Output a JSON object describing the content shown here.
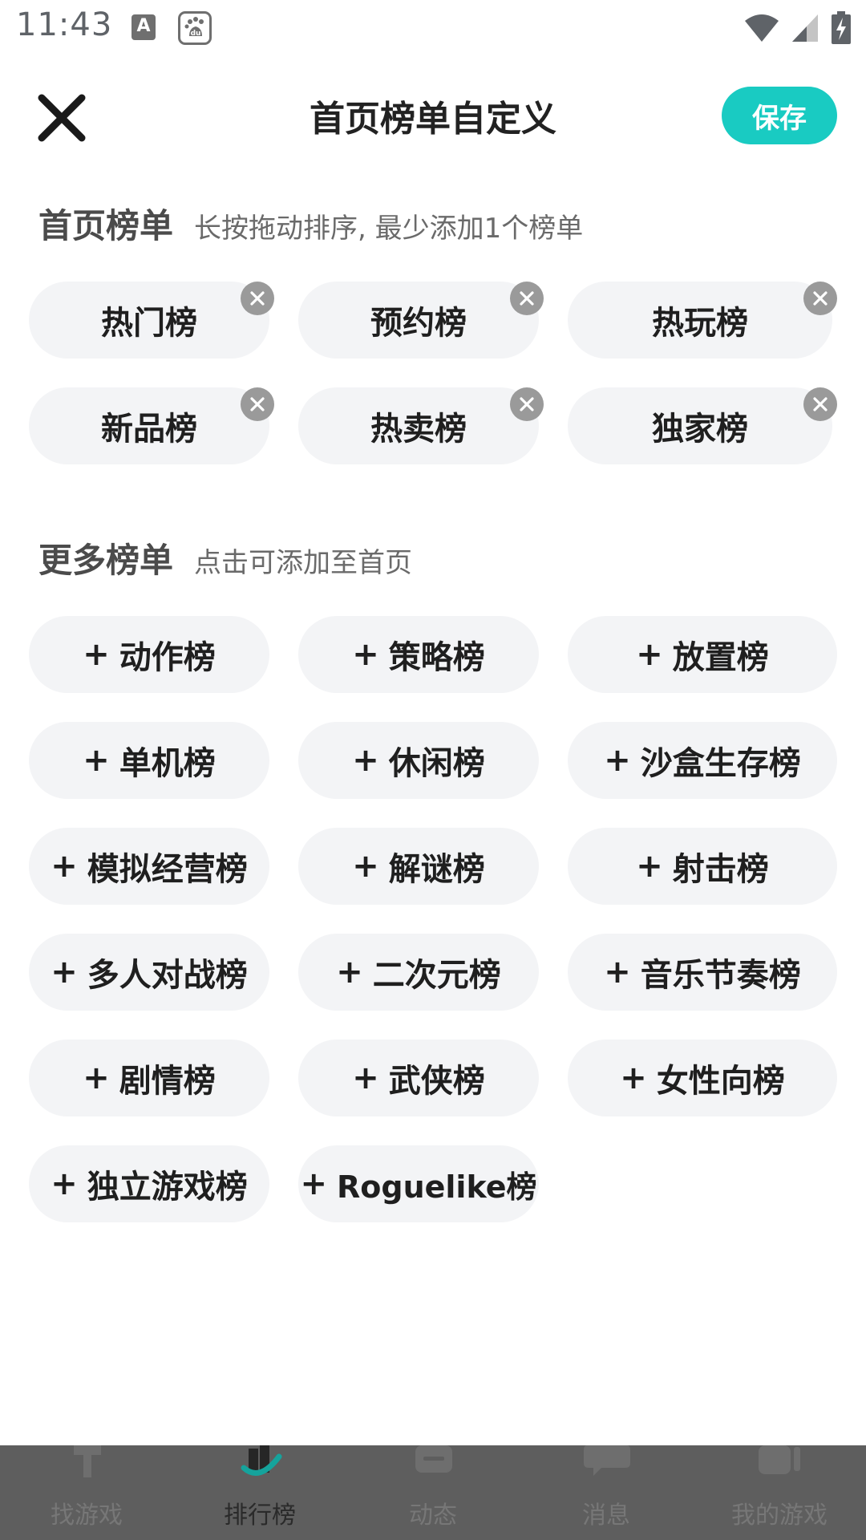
{
  "status_bar": {
    "time": "11:43",
    "notif_a_letter": "A",
    "notif_du_label": "du",
    "icons": [
      "wifi-icon",
      "signal-icon",
      "battery-charging-icon"
    ]
  },
  "header": {
    "title": "首页榜单自定义",
    "save_label": "保存",
    "close_icon": "close-icon"
  },
  "home_section": {
    "title": "首页榜单",
    "subtitle": "长按拖动排序, 最少添加1个榜单",
    "items": [
      "热门榜",
      "预约榜",
      "热玩榜",
      "新品榜",
      "热卖榜",
      "独家榜"
    ]
  },
  "more_section": {
    "title": "更多榜单",
    "subtitle": "点击可添加至首页",
    "plus": "+",
    "items": [
      "动作榜",
      "策略榜",
      "放置榜",
      "单机榜",
      "休闲榜",
      "沙盒生存榜",
      "模拟经营榜",
      "解谜榜",
      "射击榜",
      "多人对战榜",
      "二次元榜",
      "音乐节奏榜",
      "剧情榜",
      "武侠榜",
      "女性向榜",
      "独立游戏榜",
      "Roguelike榜"
    ]
  },
  "bottom_nav": {
    "items": [
      {
        "label": "找游戏",
        "icon": "find-game-icon"
      },
      {
        "label": "排行榜",
        "icon": "ranking-icon"
      },
      {
        "label": "动态",
        "icon": "feed-icon"
      },
      {
        "label": "消息",
        "icon": "message-icon"
      },
      {
        "label": "我的游戏",
        "icon": "my-games-icon"
      }
    ],
    "active_index": 1
  },
  "colors": {
    "accent": "#19cbc2",
    "chip_bg": "#f3f4f6",
    "remove_badge": "#9a9a9a",
    "overlay": "#5e5e5e"
  }
}
